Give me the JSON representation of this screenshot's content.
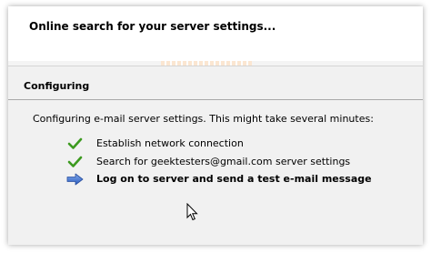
{
  "header": {
    "title": "Online search for your server settings..."
  },
  "section": {
    "title": "Configuring",
    "message": "Configuring e-mail server settings. This might take several minutes:"
  },
  "steps": [
    {
      "label": "Establish network connection",
      "status": "done",
      "icon": "checkmark-icon"
    },
    {
      "label": "Search for geektesters@gmail.com server settings",
      "status": "done",
      "icon": "checkmark-icon"
    },
    {
      "label": "Log on to server and send a test e-mail message",
      "status": "in-progress",
      "icon": "arrow-right-icon"
    }
  ],
  "colors": {
    "check": "#3c9a1f",
    "arrow": "#3d6fc9",
    "panel_bg": "#f1f1f1"
  }
}
